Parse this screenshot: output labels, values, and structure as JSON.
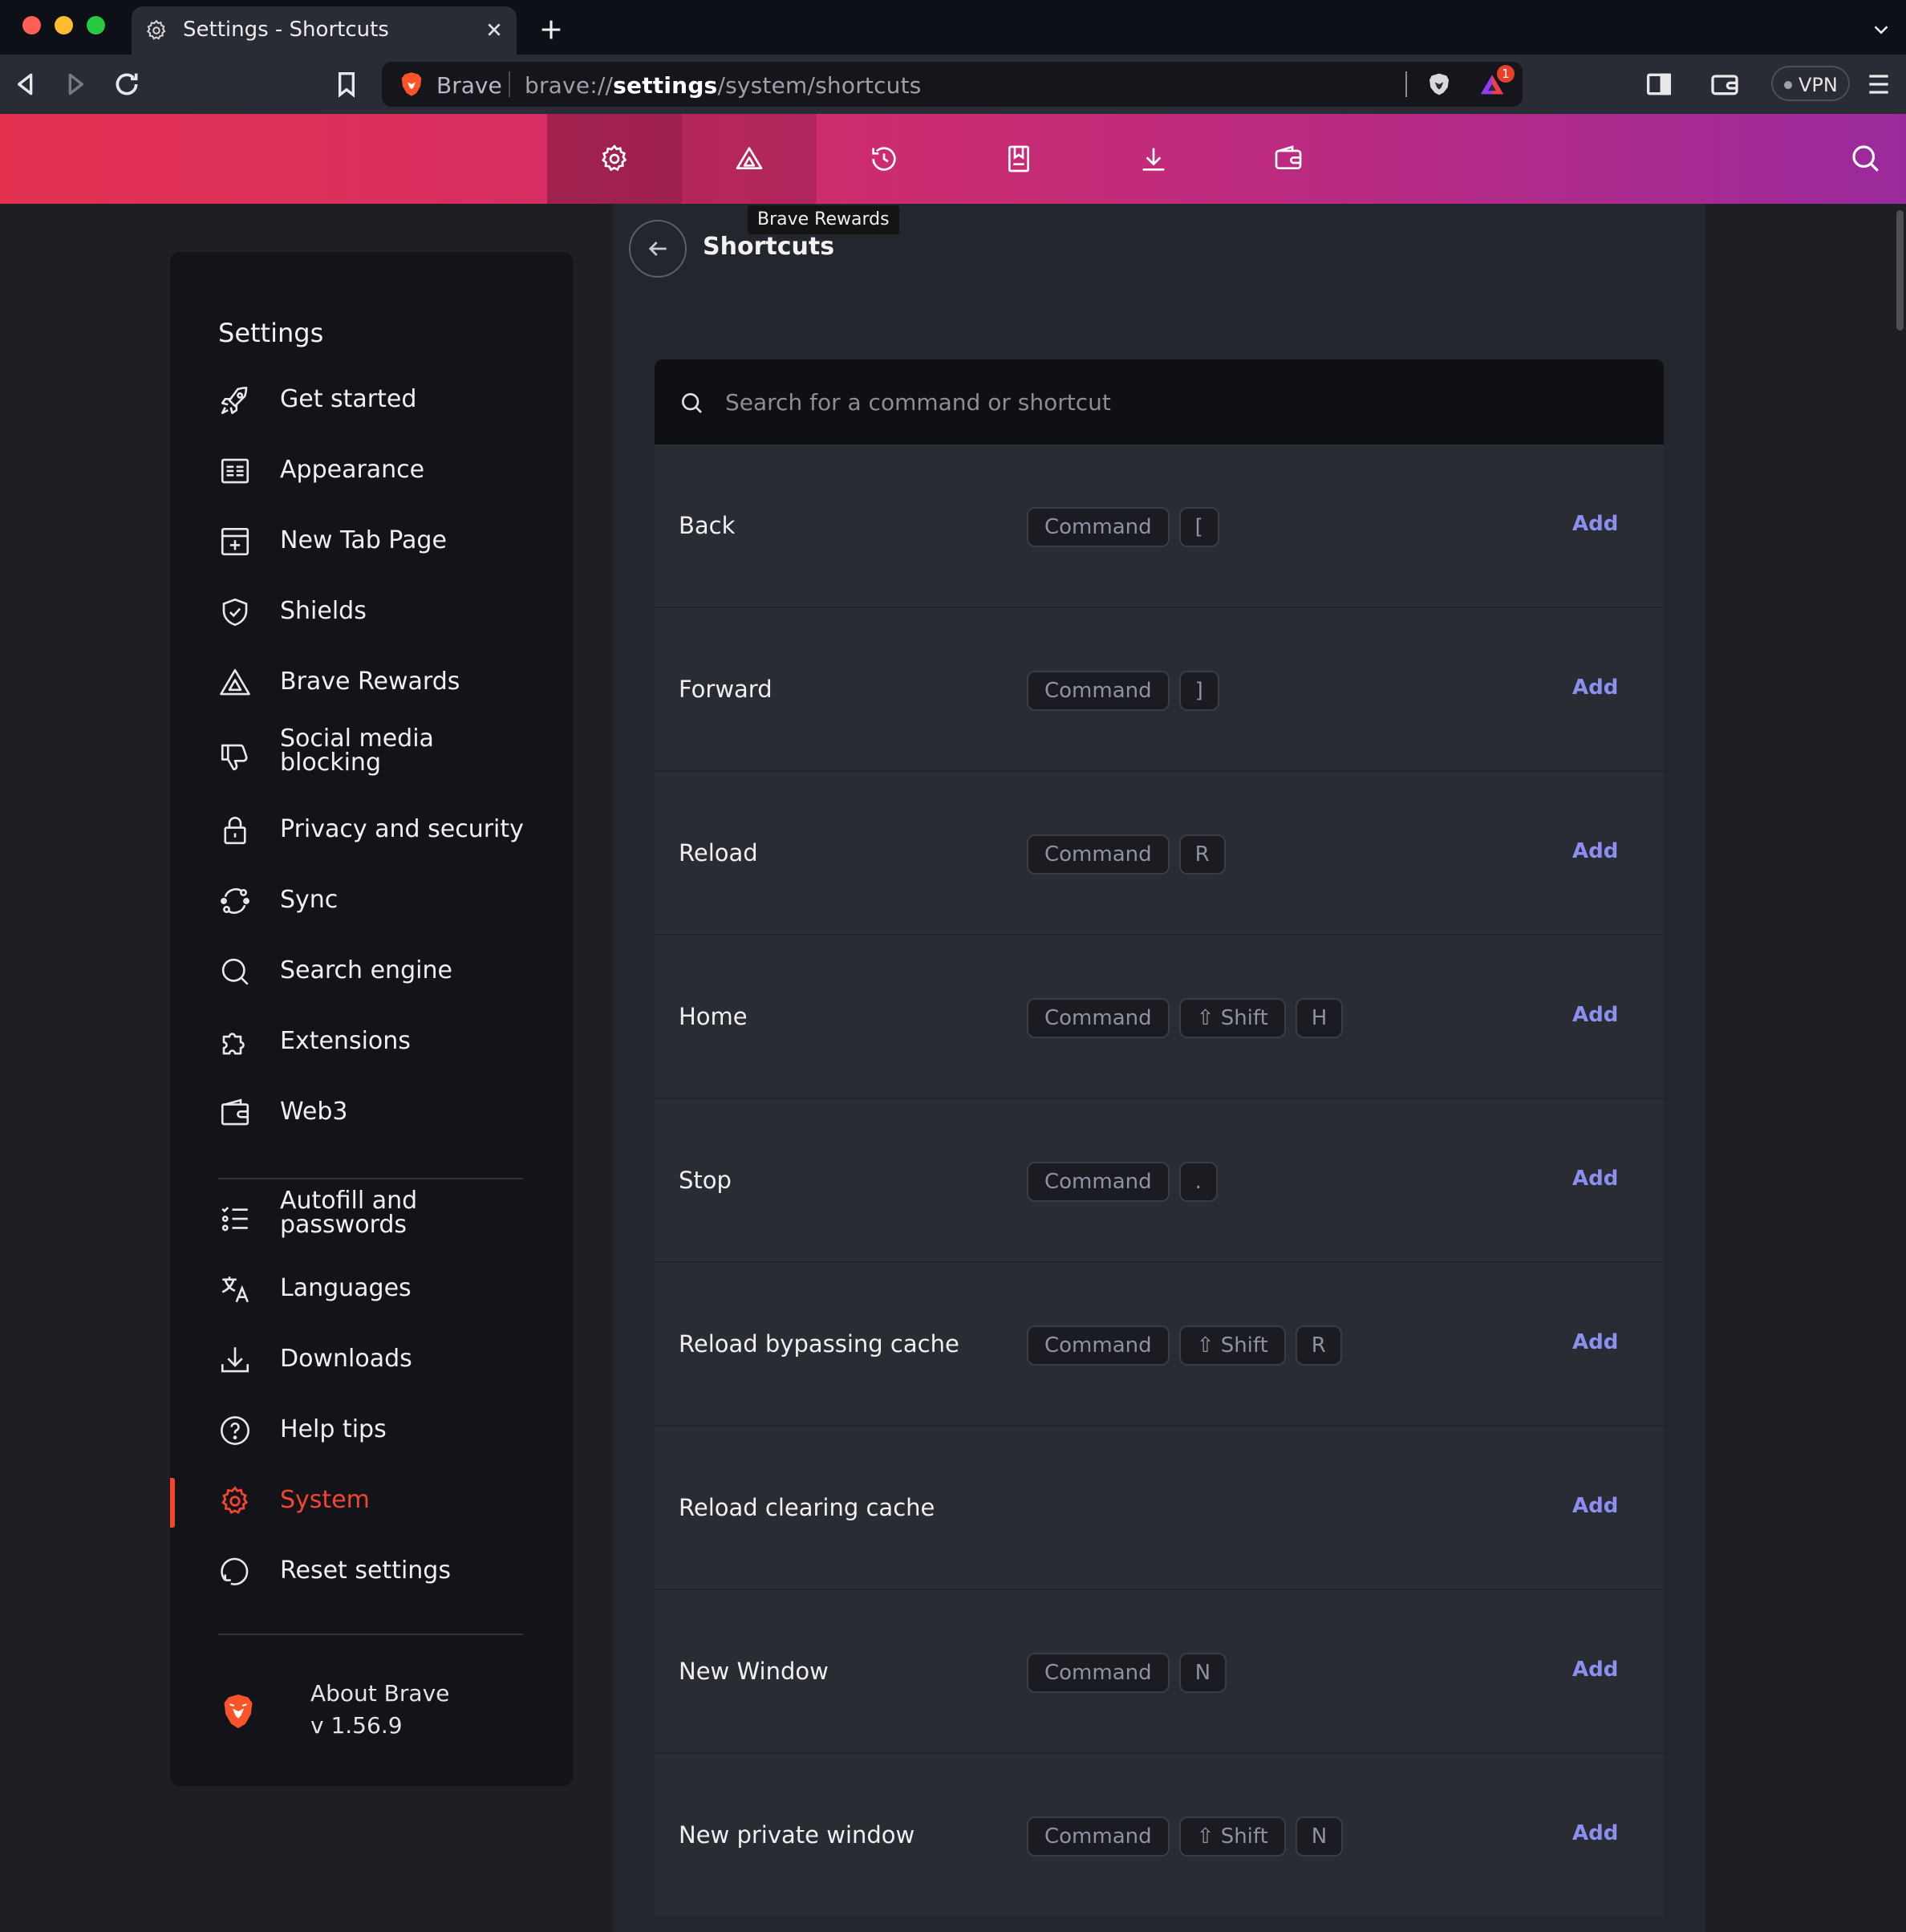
{
  "window": {
    "tab_title": "Settings - Shortcuts"
  },
  "toolbar": {
    "site_name": "Brave",
    "url_scheme": "brave://",
    "url_host": "settings",
    "url_path": "/system/shortcuts",
    "rewards_badge": "1",
    "vpn_label": "VPN"
  },
  "settings_bar": {
    "tooltip": "Brave Rewards",
    "icons": [
      "settings-icon",
      "rewards-icon",
      "history-icon",
      "bookmarks-icon",
      "downloads-icon",
      "wallet-icon"
    ]
  },
  "sidebar": {
    "title": "Settings",
    "items": [
      {
        "label": "Get started",
        "icon": "rocket-icon"
      },
      {
        "label": "Appearance",
        "icon": "appearance-icon"
      },
      {
        "label": "New Tab Page",
        "icon": "new-tab-icon"
      },
      {
        "label": "Shields",
        "icon": "shield-icon"
      },
      {
        "label": "Brave Rewards",
        "icon": "rewards-icon"
      },
      {
        "label": "Social media blocking",
        "icon": "thumbs-down-icon"
      },
      {
        "label": "Privacy and security",
        "icon": "lock-icon"
      },
      {
        "label": "Sync",
        "icon": "sync-icon"
      },
      {
        "label": "Search engine",
        "icon": "search-icon"
      },
      {
        "label": "Extensions",
        "icon": "puzzle-icon"
      },
      {
        "label": "Web3",
        "icon": "wallet-icon"
      },
      {
        "label": "Autofill and passwords",
        "icon": "list-check-icon"
      },
      {
        "label": "Languages",
        "icon": "translate-icon"
      },
      {
        "label": "Downloads",
        "icon": "download-icon"
      },
      {
        "label": "Help tips",
        "icon": "help-icon"
      },
      {
        "label": "System",
        "icon": "gear-icon",
        "active": true
      },
      {
        "label": "Reset settings",
        "icon": "reset-icon"
      }
    ],
    "about_label": "About Brave",
    "version": "v 1.56.9"
  },
  "page": {
    "title": "Shortcuts",
    "search_placeholder": "Search for a command or shortcut",
    "add_label": "Add",
    "shortcuts": [
      {
        "command": "Back",
        "keys": [
          "Command",
          "["
        ]
      },
      {
        "command": "Forward",
        "keys": [
          "Command",
          "]"
        ]
      },
      {
        "command": "Reload",
        "keys": [
          "Command",
          "R"
        ]
      },
      {
        "command": "Home",
        "keys": [
          "Command",
          "⇧ Shift",
          "H"
        ]
      },
      {
        "command": "Stop",
        "keys": [
          "Command",
          "."
        ]
      },
      {
        "command": "Reload bypassing cache",
        "keys": [
          "Command",
          "⇧ Shift",
          "R"
        ]
      },
      {
        "command": "Reload clearing cache",
        "keys": []
      },
      {
        "command": "New Window",
        "keys": [
          "Command",
          "N"
        ]
      },
      {
        "command": "New private window",
        "keys": [
          "Command",
          "⇧ Shift",
          "N"
        ]
      }
    ]
  },
  "colors": {
    "accent": "#f4452f",
    "link": "#8b8ff0",
    "bar_start": "#e3304f",
    "bar_end": "#9a2a9c"
  }
}
